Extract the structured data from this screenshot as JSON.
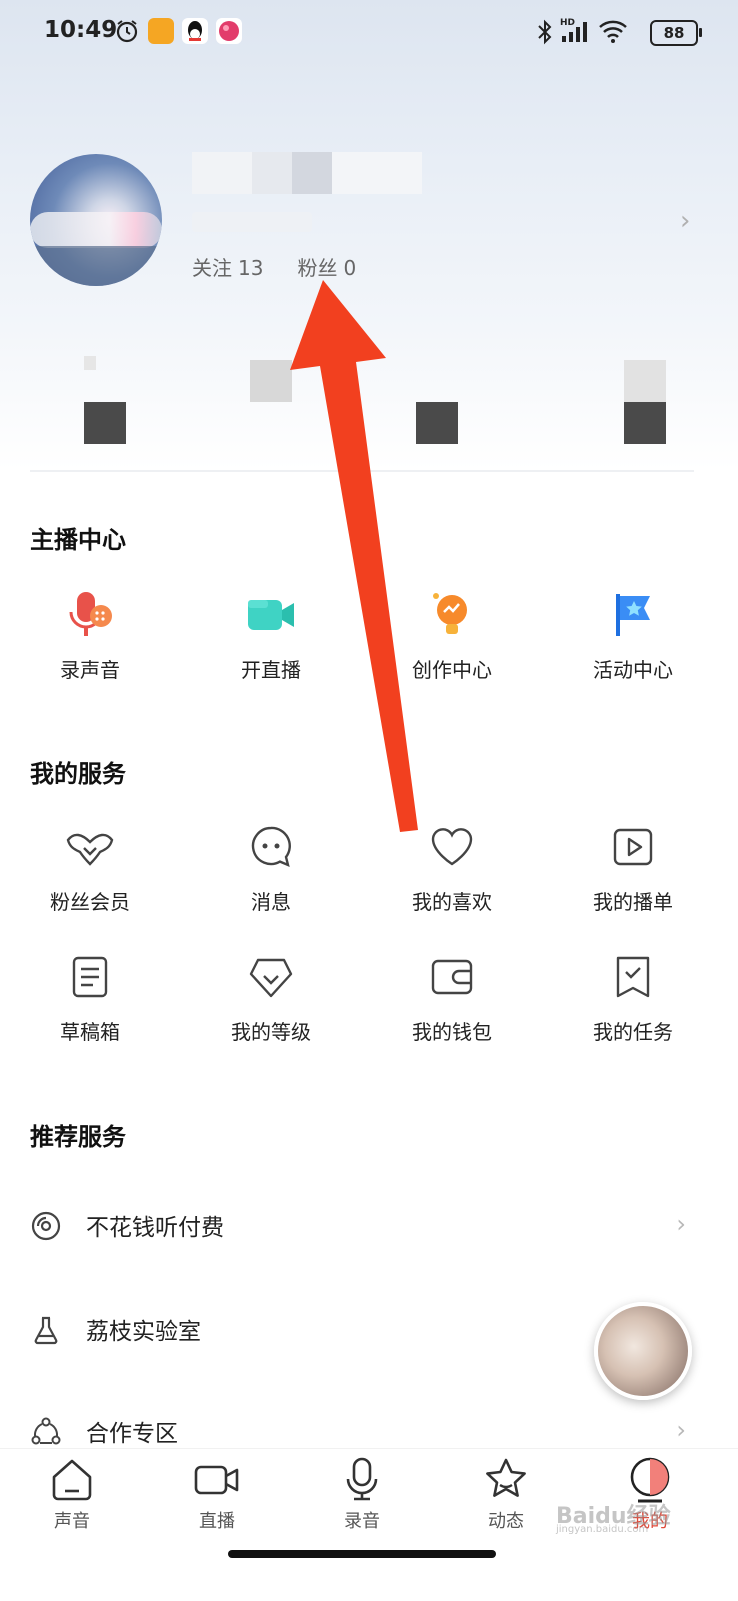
{
  "status_bar": {
    "time": "10:49",
    "battery": "88",
    "network": "HD"
  },
  "profile": {
    "following_label": "关注",
    "following_count": "13",
    "fans_label": "粉丝",
    "fans_count": "0"
  },
  "anchor_center": {
    "title": "主播中心",
    "items": [
      {
        "label": "录声音",
        "icon": "mic-record-icon"
      },
      {
        "label": "开直播",
        "icon": "video-camera-icon"
      },
      {
        "label": "创作中心",
        "icon": "lightbulb-icon"
      },
      {
        "label": "活动中心",
        "icon": "flag-star-icon"
      }
    ]
  },
  "my_services": {
    "title": "我的服务",
    "items": [
      {
        "label": "粉丝会员",
        "icon": "wing-heart-icon"
      },
      {
        "label": "消息",
        "icon": "chat-bubble-icon"
      },
      {
        "label": "我的喜欢",
        "icon": "heart-icon"
      },
      {
        "label": "我的播单",
        "icon": "playlist-icon"
      },
      {
        "label": "草稿箱",
        "icon": "draft-doc-icon"
      },
      {
        "label": "我的等级",
        "icon": "diamond-level-icon"
      },
      {
        "label": "我的钱包",
        "icon": "wallet-icon"
      },
      {
        "label": "我的任务",
        "icon": "task-bookmark-icon"
      }
    ]
  },
  "recommended": {
    "title": "推荐服务",
    "items": [
      {
        "label": "不花钱听付费",
        "icon": "disc-icon"
      },
      {
        "label": "荔枝实验室",
        "icon": "flask-icon"
      },
      {
        "label": "合作专区",
        "icon": "cooperation-icon"
      }
    ]
  },
  "bottom_nav": {
    "items": [
      {
        "label": "声音",
        "icon": "home-icon"
      },
      {
        "label": "直播",
        "icon": "live-camera-icon"
      },
      {
        "label": "录音",
        "icon": "microphone-icon"
      },
      {
        "label": "动态",
        "icon": "star-icon"
      },
      {
        "label": "我的",
        "icon": "profile-icon"
      }
    ],
    "active_index": 4
  },
  "colors": {
    "accent": "#e04a3a",
    "arrow": "#f2401f"
  },
  "watermark": {
    "text": "Baidu经验",
    "sub": "jingyan.baidu.com"
  }
}
